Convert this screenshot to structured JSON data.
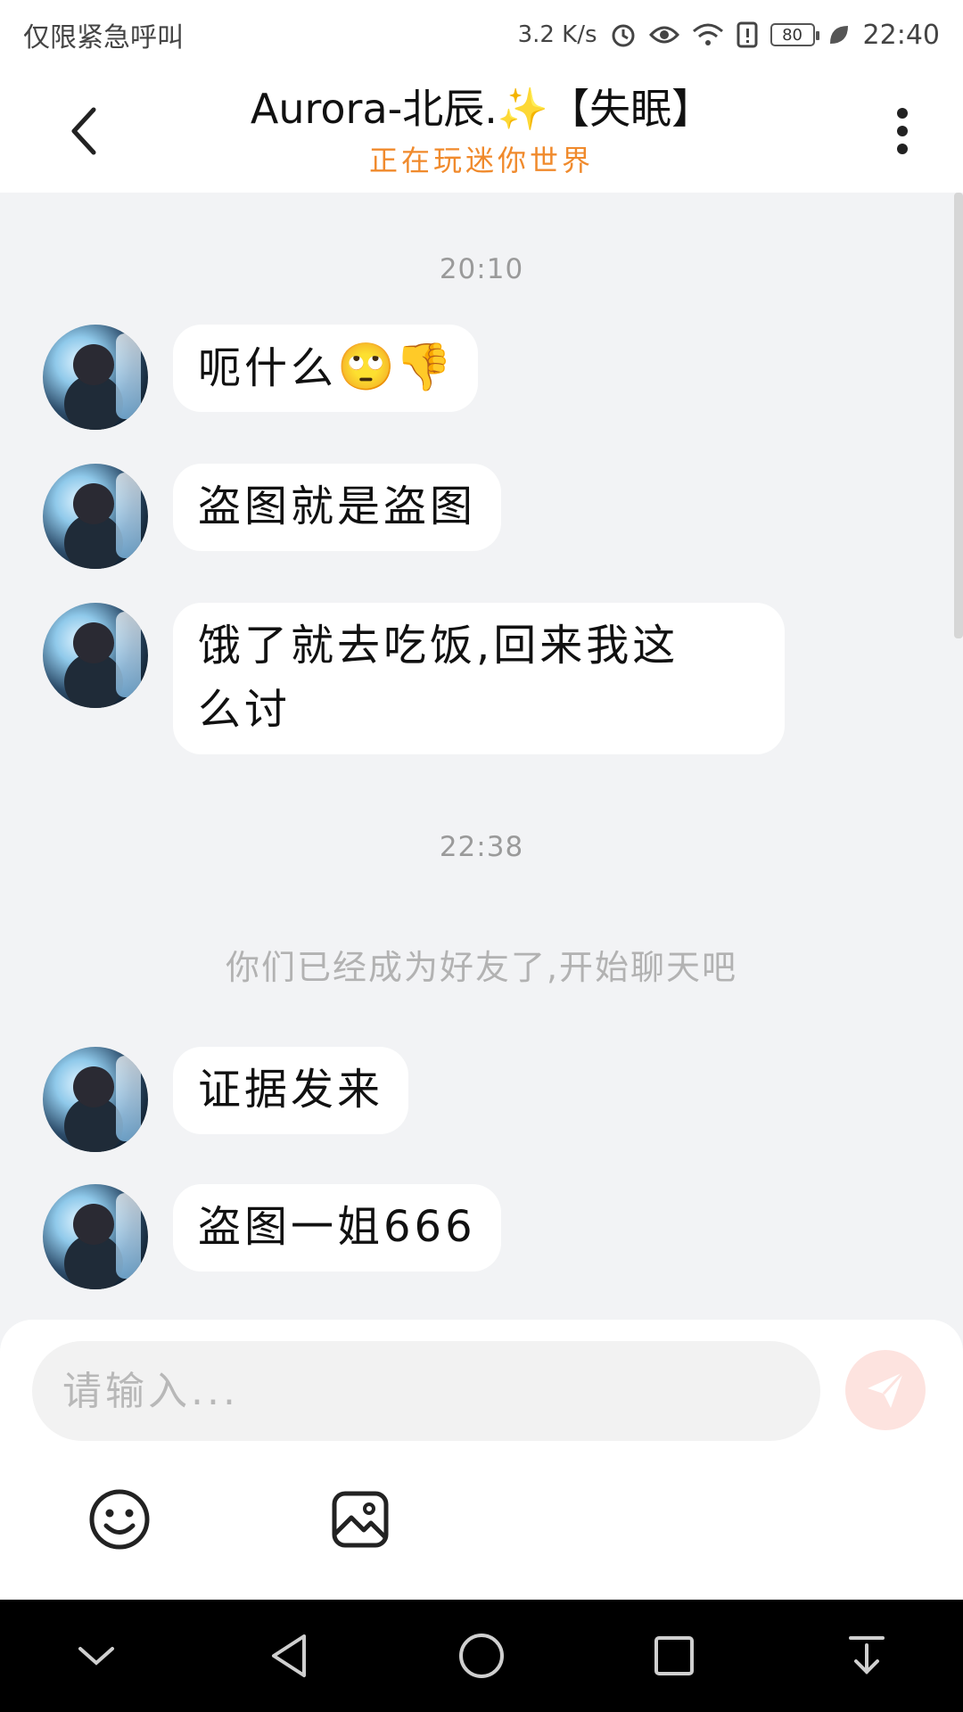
{
  "status_bar": {
    "carrier": "仅限紧急呼叫",
    "net_speed": "3.2 K/s",
    "battery": "80",
    "time": "22:40"
  },
  "header": {
    "title": "Aurora-北辰.✨【失眠】",
    "subtitle": "正在玩迷你世界"
  },
  "chat": {
    "timestamps": [
      "20:10",
      "22:38"
    ],
    "messages_group1": [
      {
        "text": "呃什么",
        "emoji": "🙄👎"
      },
      {
        "text": "盗图就是盗图"
      },
      {
        "text_line1": "饿了就去吃饭,回来我这",
        "text_line2": "么讨"
      }
    ],
    "system_note": "你们已经成为好友了,开始聊天吧",
    "messages_group2": [
      {
        "text": "证据发来"
      },
      {
        "text": "盗图一姐666"
      }
    ]
  },
  "composer": {
    "placeholder": "请输入..."
  },
  "icons": {
    "back": "chevron-left-icon",
    "more": "more-vertical-icon",
    "send": "send-icon",
    "emoji": "smiley-icon",
    "image": "image-icon"
  },
  "colors": {
    "subtitle": "#f08a2c",
    "send_button_bg": "#fde3df",
    "send_icon": "#ffffff",
    "chat_bg": "#f2f3f5"
  }
}
